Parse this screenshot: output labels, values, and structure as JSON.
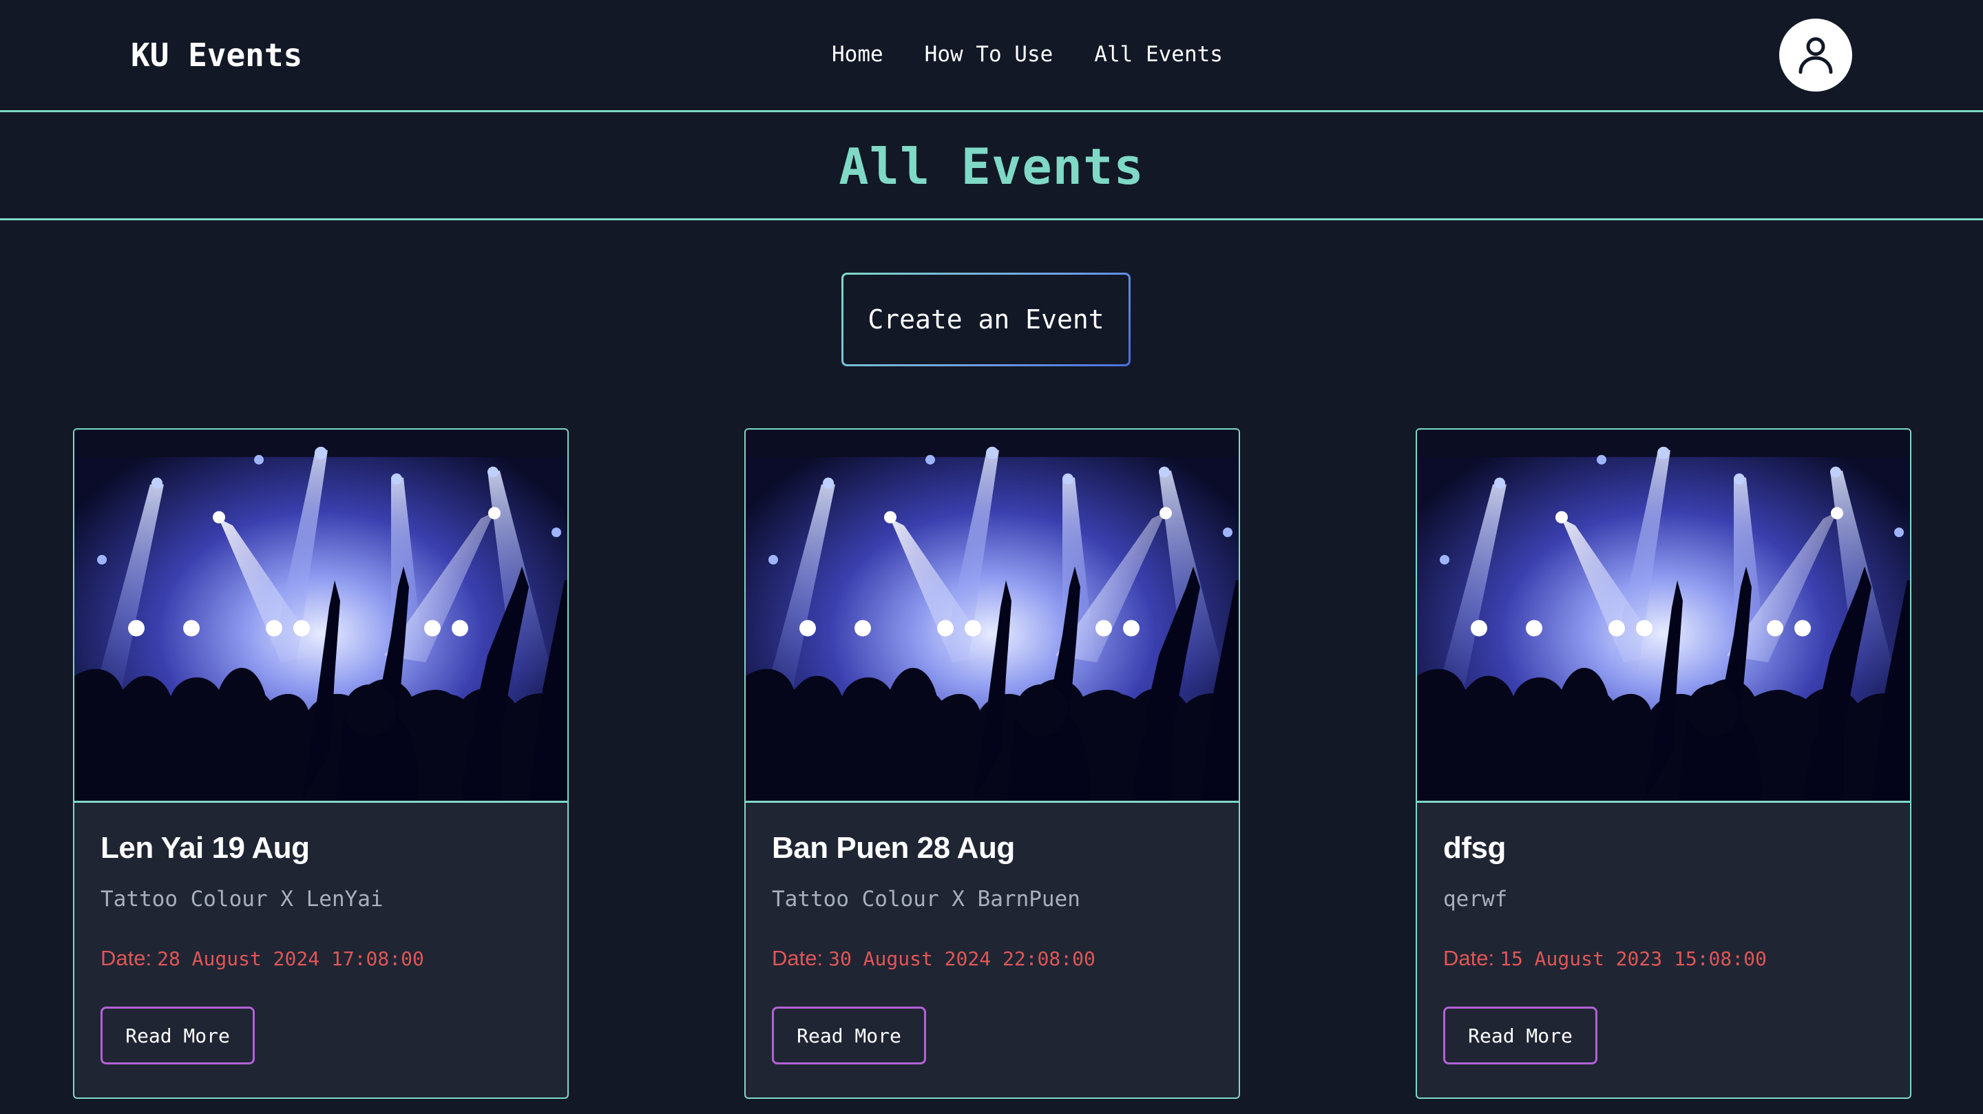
{
  "header": {
    "brand": "KU Events",
    "nav": [
      {
        "label": "Home"
      },
      {
        "label": "How To Use"
      },
      {
        "label": "All Events"
      }
    ],
    "avatar_icon": "user-icon"
  },
  "page": {
    "title": "All Events",
    "create_button": "Create an Event"
  },
  "events": [
    {
      "title": "Len Yai 19 Aug",
      "description": "Tattoo Colour X LenYai",
      "date_label": "Date:",
      "date_value": "28 August 2024 17:08:00",
      "read_more": "Read More",
      "image": "concert-crowd-image"
    },
    {
      "title": "Ban Puen 28 Aug",
      "description": "Tattoo Colour X BarnPuen",
      "date_label": "Date:",
      "date_value": "30 August 2024 22:08:00",
      "read_more": "Read More",
      "image": "concert-crowd-image"
    },
    {
      "title": "dfsg",
      "description": "qerwf",
      "date_label": "Date:",
      "date_value": "15 August 2023 15:08:00",
      "read_more": "Read More",
      "image": "concert-crowd-image"
    }
  ],
  "colors": {
    "background": "#121826",
    "accent": "#7fd9c6",
    "card_bg": "#1f2533",
    "date": "#e05656",
    "read_more_border": "#b362d6"
  }
}
